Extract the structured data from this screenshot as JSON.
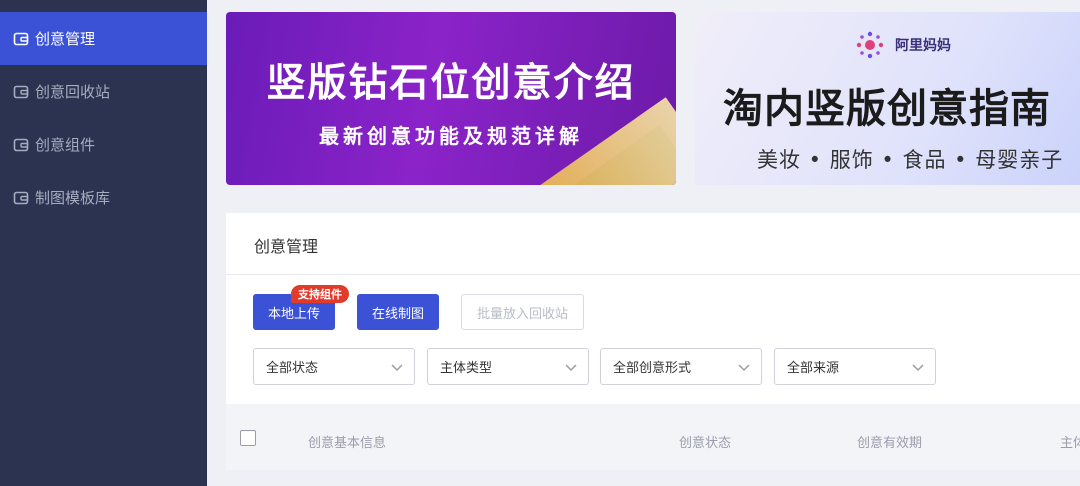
{
  "sidebar": {
    "items": [
      {
        "label": "创意管理",
        "active": true
      },
      {
        "label": "创意回收站",
        "active": false
      },
      {
        "label": "创意组件",
        "active": false
      },
      {
        "label": "制图模板库",
        "active": false
      }
    ],
    "icon": "wallet-icon"
  },
  "banners": [
    {
      "title": "竖版钻石位创意介绍",
      "subtitle": "最新创意功能及规范详解"
    },
    {
      "logo_text": "阿里妈妈",
      "title": "淘内竖版创意指南",
      "subtitle": "美妆 • 服饰 • 食品 • 母婴亲子"
    }
  ],
  "panel": {
    "title": "创意管理",
    "buttons": {
      "upload": "本地上传",
      "upload_badge": "支持组件",
      "online_design": "在线制图",
      "batch_recycle": "批量放入回收站"
    },
    "filters": [
      "全部状态",
      "主体类型",
      "全部创意形式",
      "全部来源"
    ],
    "table_headers": [
      "创意基本信息",
      "创意状态",
      "创意有效期",
      "主体"
    ]
  },
  "colors": {
    "accent": "#3b52d6",
    "sidebar_bg": "#2c3350",
    "badge_red": "#e23b2c",
    "banner_purple": "#7a20c0"
  }
}
